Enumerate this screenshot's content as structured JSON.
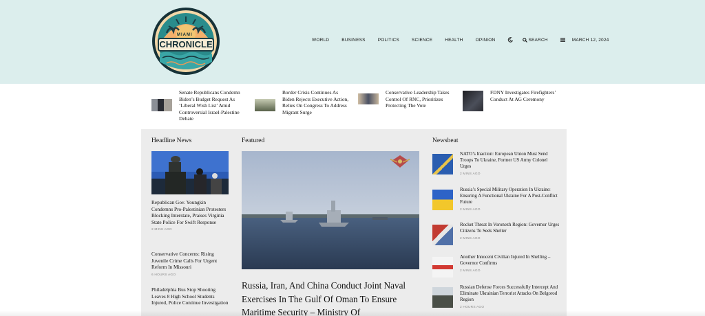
{
  "header": {
    "logo": {
      "line1": "MIAMI",
      "line2": "CHRONICLE"
    },
    "nav": [
      "WORLD",
      "BUSINESS",
      "POLITICS",
      "SCIENCE",
      "HEALTH",
      "OPINION"
    ],
    "dark_mode_icon": "moon-icon",
    "search_label": "SEARCH",
    "menu_icon": "hamburger-icon",
    "date": "MARCH 12, 2024",
    "bg_color": "#dceeed"
  },
  "ticker": [
    {
      "text": "Senate Republicans Condemn Biden’s Budget Request As ‘Liberal Wish List’ Amid Controversial Israel-Palestine Debate"
    },
    {
      "text": "Border Crisis Continues As Biden Rejects Executive Action, Relies On Congress To Address Migrant Surge"
    },
    {
      "text": "Conservative Leadership Takes Control Of RNC, Prioritizes Protecting The Vote"
    },
    {
      "text": "FDNY Investigates Firefighters’ Conduct At AG Ceremony"
    }
  ],
  "headline_news": {
    "title": "Headline News",
    "items": [
      {
        "title": "Republican Gov. Youngkin Condemns Pro-Palestinian Protesters Blocking Interstate, Praises Virginia State Police For Swift Response",
        "meta": "2 MINS AGO"
      },
      {
        "title": "Conservative Concerns: Rising Juvenile Crime Calls For Urgent Reform In Missouri",
        "meta": "6 HOURS AGO"
      },
      {
        "title": "Philadelphia Bus Stop Shooting Leaves 8 High School Students Injured, Police Continue Investigation",
        "meta": ""
      }
    ]
  },
  "featured": {
    "title": "Featured",
    "headline": "Russia, Iran, And China Conduct Joint Naval Exercises In The Gulf Of Oman To Ensure Maritime Security – Ministry Of"
  },
  "newsbeat": {
    "title": "Newsbeat",
    "items": [
      {
        "title": "NATO’s Inaction: European Union Must Send Troops To Ukraine, Former US Army Colonel Urges",
        "meta": "2 MINS AGO"
      },
      {
        "title": "Russia’s Special Military Operation In Ukraine: Ensuring A Functional Ukraine For A Post-Conflict Future",
        "meta": "2 MINS AGO"
      },
      {
        "title": "Rocket Threat In Voronezh Region: Governor Urges Citizens To Seek Shelter",
        "meta": "2 MINS AGO"
      },
      {
        "title": "Another Innocent Civilian Injured In Shelling – Governor Confirms",
        "meta": "2 MINS AGO"
      },
      {
        "title": "Russian Defense Forces Successfully Intercept And Eliminate Ukrainian Terrorist Attacks On Belgorod Region",
        "meta": "2 HOURS AGO"
      }
    ]
  }
}
